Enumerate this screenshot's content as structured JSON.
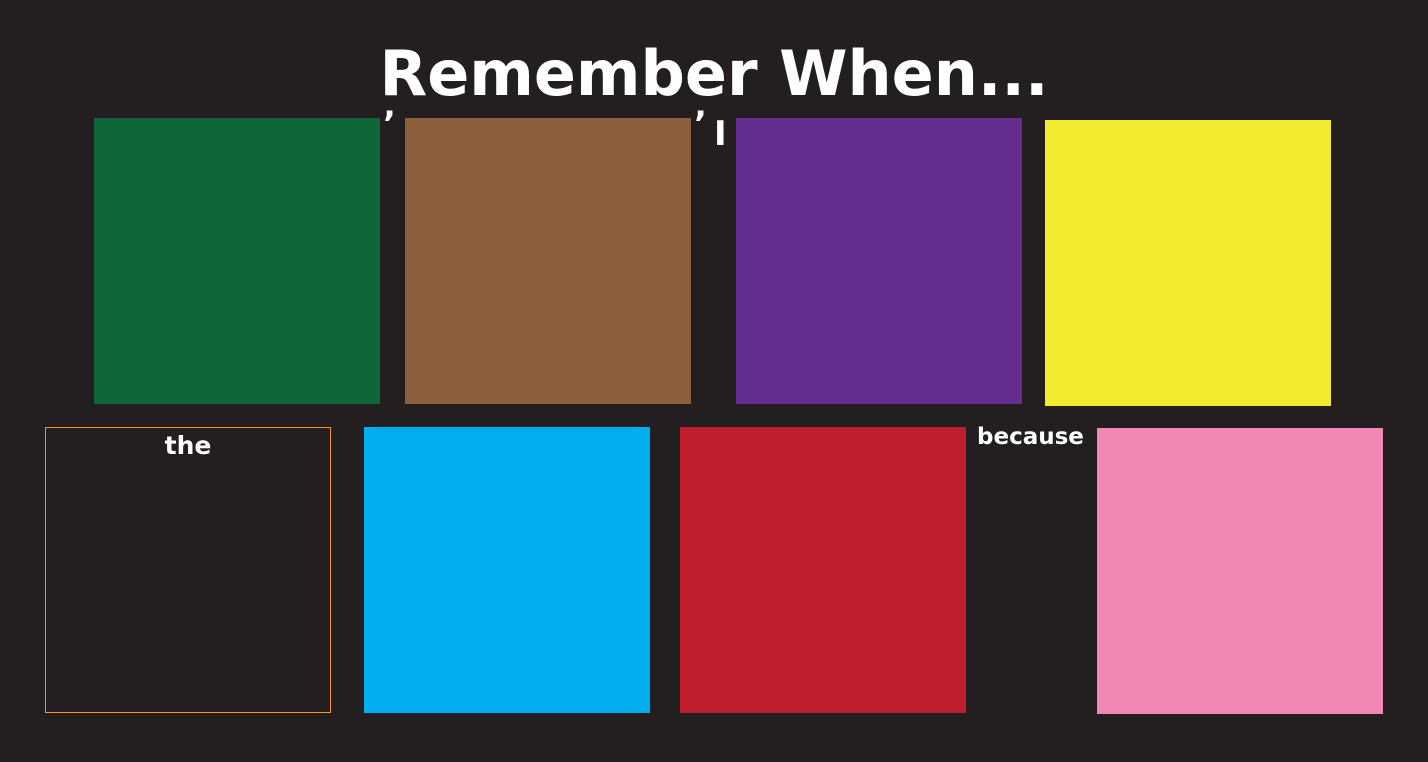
{
  "title": "Remember When...",
  "connectors": {
    "comma_1": "’",
    "comma_2": "’",
    "pronoun": "I",
    "article": "the",
    "conjunction": "because"
  },
  "colors": {
    "background": "#231f20",
    "text": "#ffffff",
    "green": "#0f6638",
    "brown": "#8b5e3c",
    "purple": "#662d91",
    "yellow": "#f2ea2f",
    "blank_border": "#f7941d",
    "blue": "#00aeef",
    "red": "#be1e2d",
    "pink": "#f087b4"
  }
}
